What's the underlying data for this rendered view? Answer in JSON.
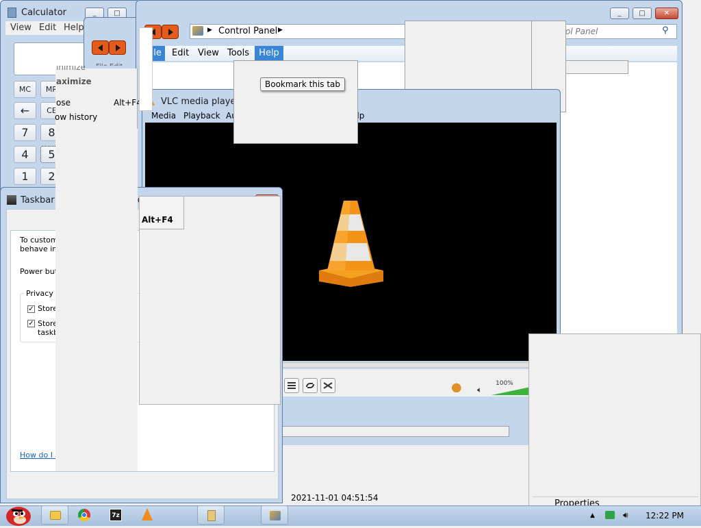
{
  "calculator": {
    "title": "Calculator",
    "menu": [
      "View",
      "Edit",
      "Help"
    ],
    "memory_keys": [
      "MC",
      "MR"
    ],
    "backspace": "←",
    "clear_entry": "CE",
    "digits_row1": [
      "7",
      "8"
    ],
    "digits_row2": [
      "4",
      "5"
    ],
    "digits_row3": [
      "1",
      "2"
    ]
  },
  "system_menu": {
    "minimize_partial": "inimize",
    "maximize": "aximize",
    "close": "ose",
    "close_shortcut": "Alt+F4",
    "history": "ow history",
    "fragment": "File  Edit",
    "alt_f4": "Alt+F4"
  },
  "explorer": {
    "breadcrumb": "Control Panel",
    "search_placeholder": "rol Panel",
    "menu": [
      "File",
      "Edit",
      "View",
      "Tools",
      "Help"
    ],
    "tooltip": "Bookmark this tab"
  },
  "vlc": {
    "title": "VLC media player",
    "menu": [
      "Media",
      "Playback",
      "Au",
      "elp"
    ],
    "volume_label": "100%",
    "volume_level": 1.0,
    "timestamp": "2021-11-01 04:51:54"
  },
  "taskbar_props": {
    "title": "Taskbar and Start Menu Prop",
    "text1a": "To customi",
    "text1b": "behave in t",
    "power": "Power butt",
    "privacy_label": "Privacy",
    "store1": "Store",
    "store2a": "Store",
    "store2b": "taskb",
    "help_link": "How do I c"
  },
  "properties_panel": {
    "properties": "Properties"
  },
  "taskbar": {
    "clock": "12:22 PM"
  }
}
